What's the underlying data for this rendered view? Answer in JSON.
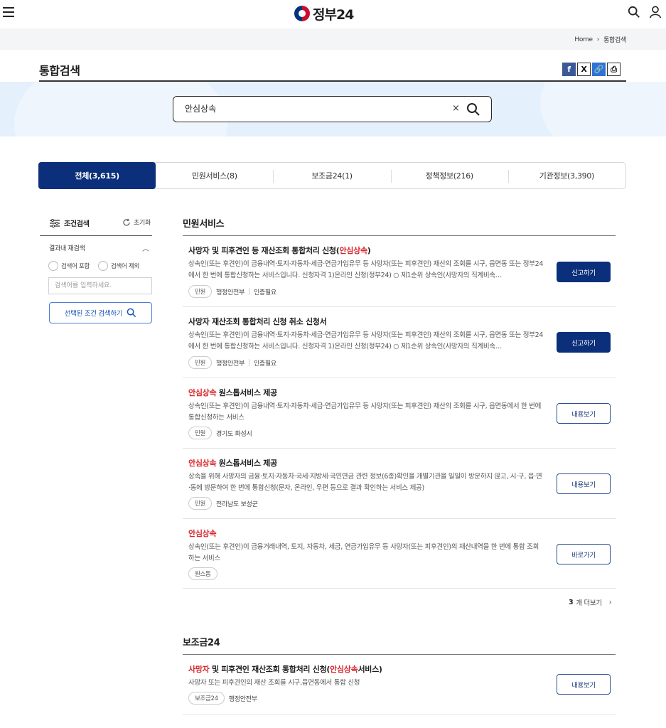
{
  "header": {
    "logo_text": "정부24",
    "icons": [
      "menu-icon",
      "search-icon",
      "user-icon"
    ]
  },
  "breadcrumb": {
    "home": "Home",
    "current": "통합검색"
  },
  "page": {
    "title": "통합검색"
  },
  "share": {
    "facebook": "f",
    "x": "X",
    "link": "🔗",
    "print": "⎙"
  },
  "search": {
    "value": "안심상속",
    "clear": "×"
  },
  "tabs": [
    {
      "label": "전체(3,615)",
      "active": true
    },
    {
      "label": "민원서비스(8)"
    },
    {
      "label": "보조금24(1)"
    },
    {
      "label": "정책정보(216)"
    },
    {
      "label": "기관정보(3,390)"
    }
  ],
  "sidebar": {
    "heading": "조건검색",
    "reset": "초기화",
    "sub_heading": "결과내 재검색",
    "radio_include": "검색어 포함",
    "radio_exclude": "검색어 제외",
    "input_placeholder": "검색어를 입력하세요.",
    "search_button": "선택된 조건 검색하기"
  },
  "sections": {
    "civil": {
      "title": "민원서비스",
      "items": [
        {
          "title_pre": "사망자 및 피후견인 등 재산조회 통합처리 신청(",
          "title_hl": "안심상속",
          "title_post": ")",
          "desc": "상속인(또는 후견인)이 금융내역·토지·자동차·세금·연금가입유무 등 사망자(또는 피후견인) 재산의 조회를 시구, 읍면동 또는 정부24에서 한 번에 통합신청하는 서비스입니다. 신청자격 1)온라인 신청(정부24) ○ 제1순위 상속인(사망자의 직계비속…",
          "tag": "민원",
          "org": "행정안전부",
          "auth": "인증필요",
          "action": "신고하기"
        },
        {
          "title_pre": "사망자 재산조회 통합처리 신청 취소 신청서",
          "title_hl": "",
          "title_post": "",
          "desc": "상속인(또는 후견인)이 금융내역·토지·자동차·세금·연금가입유무 등 사망자(또는 피후견인) 재산의 조회를 시구, 읍면동 또는 정부24에서 한 번에 통합신청하는 서비스입니다. 신청자격 1)온라인 신청(정부24) ○ 제1순위 상속인(사망자의 직계비속…",
          "tag": "민원",
          "org": "행정안전부",
          "auth": "인증필요",
          "action": "신고하기"
        },
        {
          "title_pre": "",
          "title_hl": "안심상속",
          "title_post": " 원스톱서비스 제공",
          "desc": "상속인(또는 후견인)이 금융내역·토지·자동차·세금·연금가입유무 등 사망자(또는 피후견인) 재산의 조회를 시구, 읍면동에서 한 번에 통합신청하는 서비스",
          "tag": "민원",
          "org": "경기도 화성시",
          "action": "내용보기"
        },
        {
          "title_pre": "",
          "title_hl": "안심상속",
          "title_post": " 원스톱서비스 제공",
          "desc": "상속을 위해 사망자의 금융·토지·자동차·국세·지방세·국민연금 관련 정보(6종)확인을 개별기관을 일일이 방문하지 않고, 시·구, 읍·면·동에 방문하여 한 번에 통합신청(문자, 온라인, 우편 등으로 결과 확인하는 서비스 제공)",
          "tag": "민원",
          "org": "전라남도 보성군",
          "action": "내용보기"
        },
        {
          "title_pre": "",
          "title_hl": "안심상속",
          "title_post": "",
          "desc": "상속인(또는 후견인)이 금융거래내역, 토지, 자동차, 세금, 연금가입유무 등 사망자(또는 피후견인)의 재산내역을 한 번에 통합 조회하는 서비스",
          "tag": "원스톱",
          "action": "바로가기"
        }
      ],
      "more_count": "3",
      "more_label": "개 더보기"
    },
    "subsidy": {
      "title": "보조금24",
      "items": [
        {
          "title_hl1": "사망자",
          "title_mid": " 및 피후견인 재산조회 통합처리 신청(",
          "title_hl2": "안심상속",
          "title_post": "서비스)",
          "desc": "사망자 또는 피후견인의 재산 조회를 시구,읍면동에서 통합 신청",
          "tag": "보조금24",
          "org": "행정안전부",
          "action": "내용보기"
        }
      ]
    }
  },
  "colors": {
    "primary": "#0b2f7a",
    "highlight": "#d7262d",
    "search_band": "#e4f0fb"
  }
}
